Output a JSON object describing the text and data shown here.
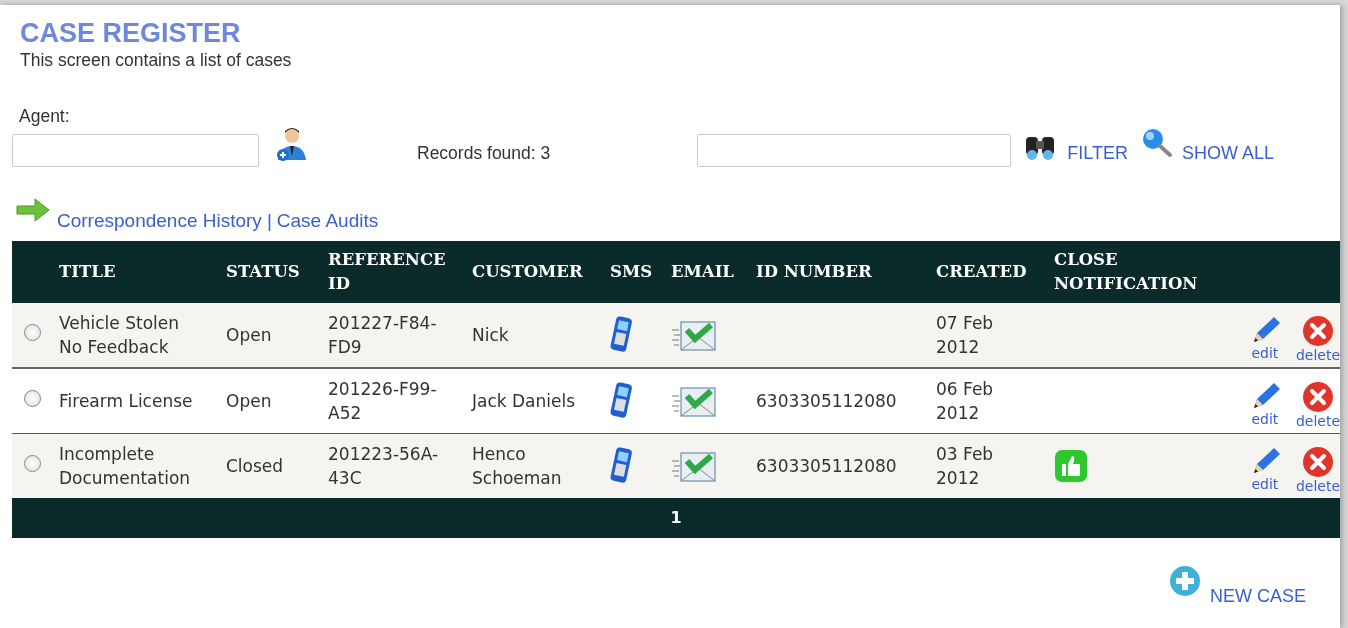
{
  "header": {
    "title": "CASE REGISTER",
    "subtitle": "This screen contains a list of cases"
  },
  "agent": {
    "label": "Agent:"
  },
  "records_found": "Records found: 3",
  "filter_button": "FILTER",
  "show_all_button": "SHOW ALL",
  "links": [
    "Correspondence History",
    "Case Audits"
  ],
  "link_separator": "|",
  "table": {
    "columns": [
      "TITLE",
      "STATUS",
      "REFERENCE ID",
      "CUSTOMER",
      "SMS",
      "EMAIL",
      "ID NUMBER",
      "CREATED",
      "CLOSE NOTIFICATION"
    ],
    "rows": [
      {
        "selected": false,
        "title": "Vehicle Stolen No Feedback",
        "status": "Open",
        "reference_id": "201227-F84-FD9",
        "customer": "Nick",
        "id_number": "",
        "created": "07 Feb 2012",
        "close_notification": false,
        "edit": "edit",
        "delete": "delete"
      },
      {
        "selected": false,
        "title": "Firearm License",
        "status": "Open",
        "reference_id": "201226-F99-A52",
        "customer": "Jack Daniels",
        "id_number": "6303305112080",
        "created": "06 Feb 2012",
        "close_notification": false,
        "edit": "edit",
        "delete": "delete"
      },
      {
        "selected": false,
        "title": "Incomplete Documentation",
        "status": "Closed",
        "reference_id": "201223-56A-43C",
        "customer": "Henco Schoeman",
        "id_number": "6303305112080",
        "created": "03 Feb 2012",
        "close_notification": true,
        "edit": "edit",
        "delete": "delete"
      }
    ],
    "pages": [
      {
        "label": "1",
        "selected": true
      }
    ]
  },
  "new_case_button": "NEW CASE"
}
